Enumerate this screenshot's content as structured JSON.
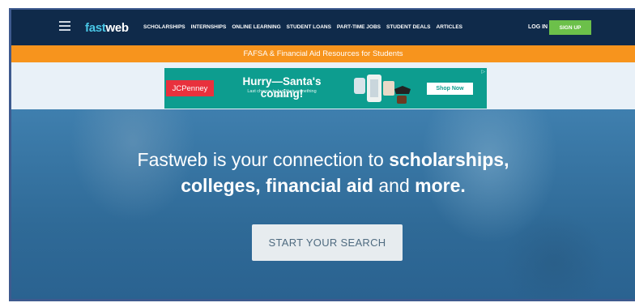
{
  "nav": {
    "logo_prefix": "fast",
    "logo_suffix": "web",
    "links": [
      "SCHOLARSHIPS",
      "INTERNSHIPS",
      "ONLINE LEARNING",
      "STUDENT LOANS",
      "PART-TIME JOBS",
      "STUDENT DEALS",
      "ARTICLES"
    ],
    "login": "LOG IN",
    "signup": "SIGN UP"
  },
  "banner": {
    "text": "FAFSA & Financial Aid Resources for Students"
  },
  "ad": {
    "brand": "JCPenney",
    "headline": "Hurry—Santa's coming!",
    "subtext": "Last chance to buy their something special.",
    "button": "Shop Now",
    "info": "▷"
  },
  "hero": {
    "line1_plain": "Fastweb is your connection to ",
    "line1_bold": "scholarships,",
    "line2_bold_a": "colleges, financial aid",
    "line2_plain": " and ",
    "line2_bold_b": "more.",
    "cta": "START YOUR SEARCH"
  },
  "colors": {
    "nav_bg": "#0f2a4a",
    "logo_accent": "#49c6e5",
    "signup_green": "#6cc04a",
    "banner_orange": "#f7941d",
    "ad_teal": "#0d9d8f",
    "jcp_red": "#e8313d",
    "hero_blue": "#2f6a97"
  }
}
